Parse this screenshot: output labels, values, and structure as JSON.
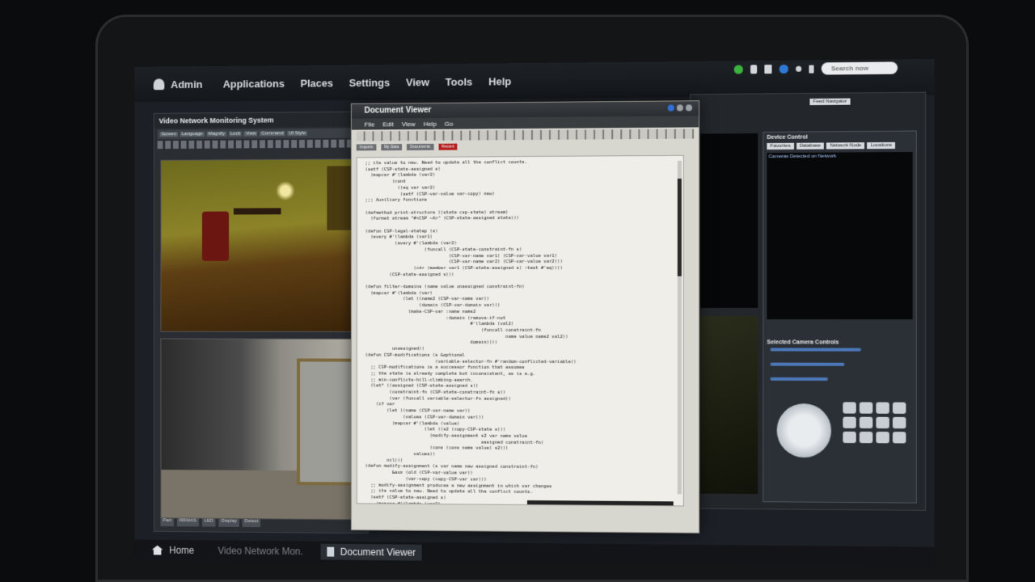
{
  "topbar": {
    "user": "Admin",
    "menu": [
      "Applications",
      "Places",
      "Settings",
      "View",
      "Tools",
      "Help"
    ],
    "search_placeholder": "Search now"
  },
  "vnm": {
    "title": "Video Network Monitoring System",
    "toolbar": [
      "Screen",
      "Language",
      "Magnify",
      "Lock",
      "View",
      "Command",
      "UI Style"
    ],
    "status": [
      "Part",
      "RRMAS",
      "LED",
      "Display",
      "Detect"
    ]
  },
  "side": {
    "title": "Device Control",
    "tabs": [
      "Favorites",
      "Database",
      "Network Node",
      "Locations"
    ],
    "list_header": "Cameras Detected on Network",
    "section": "Selected Camera Controls",
    "top_buttons": [
      "Feed Navigator"
    ]
  },
  "docviewer": {
    "title": "Document Viewer",
    "menu": [
      "File",
      "Edit",
      "View",
      "Help",
      "Go"
    ],
    "tabs": [
      "Imports",
      "My Data",
      "Documents",
      "Recent"
    ],
    "code": ";; its value to new. Need to update all the conflict counts.\n(setf (CSP-state-assigned s)\n  (mapcar #'(lambda (var2)\n          (cond\n            ((eq var var2)\n             (setf (CSP-var-value var-copy) new)\n;;; Auxiliary functions\n\n(defmethod print-structure ((state csp-state) stream)\n  (format stream \"#<CSP ~A>\" (CSP-state-assigned state)))\n\n(defun CSP-legal-statep (s)\n  (every #'(lambda (var1)\n           (every #'(lambda (var2)\n                      (funcall (CSP-state-constraint-fn s)\n                               (CSP-var-name var1) (CSP-var-value var1)\n                               (CSP-var-name var2) (CSP-var-value var2)))\n                  (cdr (member var1 (CSP-state-assigned s) :test #'eq))))\n         (CSP-state-assigned s)))\n\n(defun filter-domains (name value unassigned constraint-fn)\n  (mapcar #'(lambda (var)\n              (let ((name2 (CSP-var-name var))\n                    (domain (CSP-var-domain var)))\n                (make-CSP-var :name name2\n                              :domain (remove-if-not\n                                       #'(lambda (val2)\n                                           (funcall constraint-fn\n                                                    name value name2 val2))\n                                       domain))))\n          unassigned))\n(defun CSP-modifications (s &optional\n                          (variable-selector-fn #'random-conflicted-variable))\n  ;; CSP-modifications is a successor function that assumes\n  ;; the state is already complete but inconsistent, as is e.g.\n  ;; min-conflicts-hill-climbing-search.\n  (let* ((assigned (CSP-state-assigned s))\n         (constraint-fn (CSP-state-constraint-fn s))\n         (var (funcall variable-selector-fn assigned))\n    (if var\n        (let ((name (CSP-var-name var))\n              (values (CSP-var-domain var)))\n          (mapcar #'(lambda (value)\n                      (let ((s2 (copy-CSP-state s)))\n                        (modify-assignment s2 var name value\n                                           assigned constraint-fn)\n                        (cons (cons name value) s2)))\n                  values))\n        nil)))\n(defun modify-assignment (s var name new assigned constraint-fn)\n          &aux (old (CSP-var-value var))\n               (var-copy (copy-CSP-var var)))\n  ;; modify-assignment produces a new assignment in which var changes\n  ;; its value to new. Need to update all the conflict counts.\n  (setf (CSP-state-assigned s)\n    (mapcar #'(lambda (var2)"
  },
  "taskbar": {
    "items": [
      "Home",
      "Video Network Mon.",
      "Document Viewer"
    ]
  }
}
